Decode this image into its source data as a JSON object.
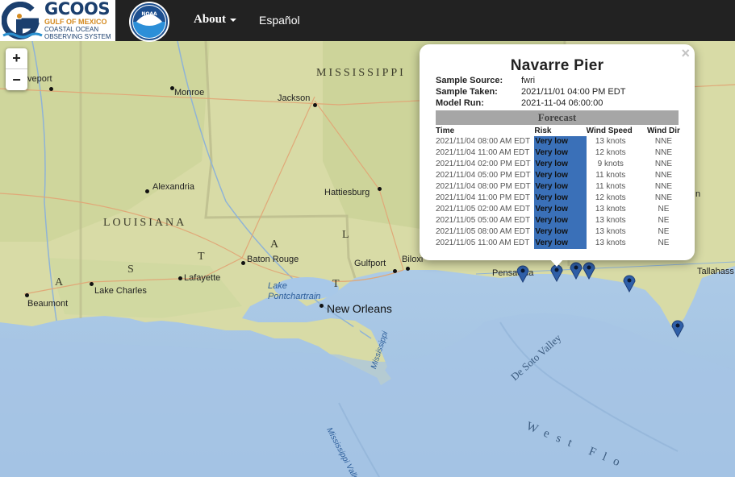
{
  "header": {
    "logo_title": "GCOOS",
    "logo_line1": "GULF OF MEXICO",
    "logo_line2": "COASTAL OCEAN",
    "logo_line3": "OBSERVING SYSTEM",
    "noaa_label": "NOAA",
    "nav_about": "About",
    "nav_espanol": "Español"
  },
  "zoom": {
    "plus": "+",
    "minus": "−"
  },
  "popup": {
    "close": "×",
    "title": "Navarre Pier",
    "sample_source_label": "Sample Source:",
    "sample_source": "fwri",
    "sample_taken_label": "Sample Taken:",
    "sample_taken": "2021/11/01 04:00 PM EDT",
    "model_run_label": "Model Run:",
    "model_run": "2021-11-04 06:00:00",
    "forecast_title": "Forecast",
    "columns": [
      "Time",
      "Risk",
      "Wind Speed",
      "Wind Dir"
    ],
    "rows": [
      {
        "time": "2021/11/04 08:00 AM EDT",
        "risk": "Very low",
        "speed": "13 knots",
        "dir": "NNE"
      },
      {
        "time": "2021/11/04 11:00 AM EDT",
        "risk": "Very low",
        "speed": "12 knots",
        "dir": "NNE"
      },
      {
        "time": "2021/11/04 02:00 PM EDT",
        "risk": "Very low",
        "speed": "9 knots",
        "dir": "NNE"
      },
      {
        "time": "2021/11/04 05:00 PM EDT",
        "risk": "Very low",
        "speed": "11 knots",
        "dir": "NNE"
      },
      {
        "time": "2021/11/04 08:00 PM EDT",
        "risk": "Very low",
        "speed": "11 knots",
        "dir": "NNE"
      },
      {
        "time": "2021/11/04 11:00 PM EDT",
        "risk": "Very low",
        "speed": "12 knots",
        "dir": "NNE"
      },
      {
        "time": "2021/11/05 02:00 AM EDT",
        "risk": "Very low",
        "speed": "13 knots",
        "dir": "NE"
      },
      {
        "time": "2021/11/05 05:00 AM EDT",
        "risk": "Very low",
        "speed": "13 knots",
        "dir": "NE"
      },
      {
        "time": "2021/11/05 08:00 AM EDT",
        "risk": "Very low",
        "speed": "13 knots",
        "dir": "NE"
      },
      {
        "time": "2021/11/05 11:00 AM EDT",
        "risk": "Very low",
        "speed": "13 knots",
        "dir": "NE"
      }
    ]
  },
  "map": {
    "colors": {
      "land": "#d9dca8",
      "water": "#b3cfe9",
      "deep_water": "#a5c4e4",
      "marker": "#2f5fa8",
      "risk": "#3a70b8"
    },
    "states": [
      "MISSISSIPPI",
      "LOUISIANA",
      "S",
      "T",
      "A",
      "T",
      "A",
      "L"
    ],
    "cities": [
      "veport",
      "Monroe",
      "Jackson",
      "Alexandria",
      "Hattiesburg",
      "Baton Rouge",
      "Gulfport",
      "Biloxi",
      "Lafayette",
      "Lake Charles",
      "Beaumont",
      "New Orleans",
      "Pensacola",
      "Tallahass",
      "n"
    ],
    "water": [
      "Lake",
      "Pontchartrain",
      "Mississippi",
      "Mississippi Valley",
      "De Soto Valley",
      "West Flo"
    ]
  }
}
